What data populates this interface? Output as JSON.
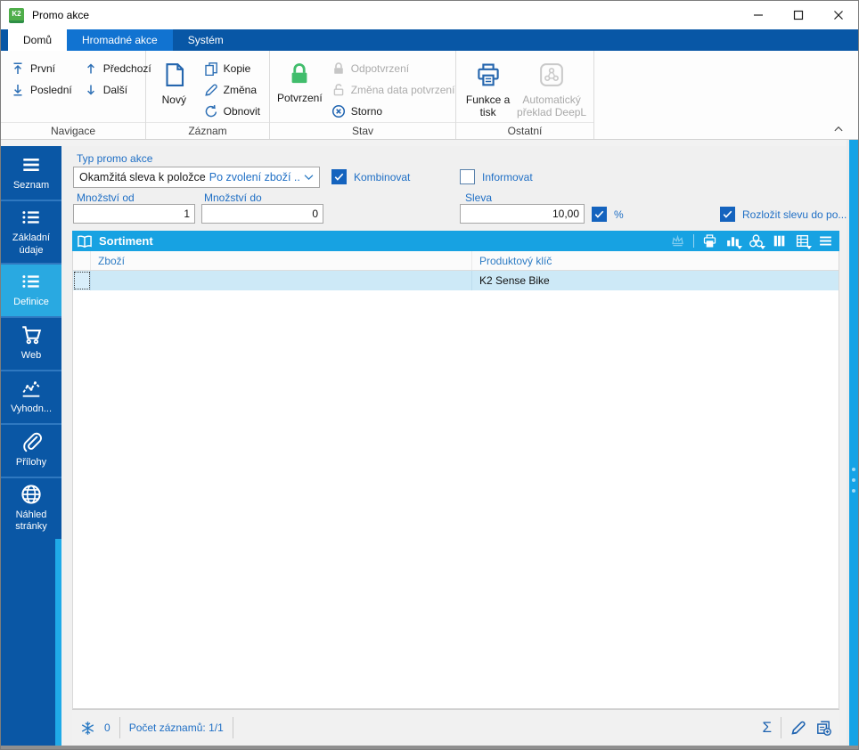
{
  "window": {
    "title": "Promo akce"
  },
  "tabs": [
    {
      "label": "Domů",
      "active": true
    },
    {
      "label": "Hromadné akce",
      "active": false
    },
    {
      "label": "Systém",
      "active": false
    }
  ],
  "ribbon": {
    "navigace": {
      "label": "Navigace",
      "first": "První",
      "last": "Poslední",
      "prev": "Předchozí",
      "next": "Další"
    },
    "zaznam": {
      "label": "Záznam",
      "new": "Nový",
      "copy": "Kopie",
      "change": "Změna",
      "refresh": "Obnovit"
    },
    "stav": {
      "label": "Stav",
      "confirm": "Potvrzení",
      "unconfirm": "Odpotvrzení",
      "change_date": "Změna data potvrzení",
      "cancel": "Storno"
    },
    "ostatni": {
      "label": "Ostatní",
      "functions": "Funkce a tisk",
      "deepl": "Automatický překlad DeepL"
    }
  },
  "sidebar": {
    "items": [
      {
        "label": "Seznam",
        "active": false
      },
      {
        "label": "Základní údaje",
        "active": false
      },
      {
        "label": "Definice",
        "active": true
      },
      {
        "label": "Web",
        "active": false
      },
      {
        "label": "Vyhodn...",
        "active": false
      },
      {
        "label": "Přílohy",
        "active": false
      },
      {
        "label": "Náhled stránky",
        "active": false
      }
    ]
  },
  "form": {
    "type_label": "Typ promo akce",
    "type_value_main": "Okamžitá sleva k položce",
    "type_value_secondary": "Po zvolení zboží ...",
    "kombinovat": {
      "label": "Kombinovat",
      "checked": true
    },
    "informovat": {
      "label": "Informovat",
      "checked": false
    },
    "mnozstvi_od": {
      "label": "Množství od",
      "value": "1"
    },
    "mnozstvi_do": {
      "label": "Množství do",
      "value": "0"
    },
    "sleva": {
      "label": "Sleva",
      "value": "10,00"
    },
    "percent": {
      "label": "%",
      "checked": true
    },
    "rozlozit": {
      "label": "Rozložit slevu do po...",
      "checked": true
    }
  },
  "panel": {
    "title": "Sortiment",
    "columns": [
      "Zboží",
      "Produktový klíč"
    ],
    "rows": [
      {
        "zbozi": "",
        "klic": "K2 Sense Bike"
      }
    ]
  },
  "status": {
    "frozen_count": "0",
    "records": "Počet záznamů: 1/1",
    "sigma": "Σ"
  },
  "colors": {
    "dark_blue": "#0857a6",
    "cyan_accent": "#17a2e2",
    "label_blue": "#1f6fc5",
    "confirm_green": "#41bd6c",
    "selected_row": "#cde9f7"
  }
}
